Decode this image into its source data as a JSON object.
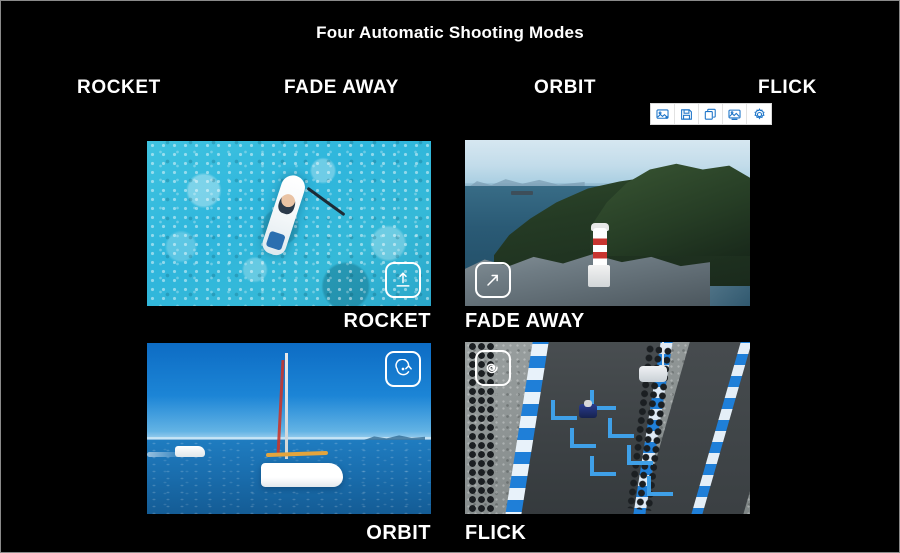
{
  "page": {
    "title": "Four Automatic Shooting Modes",
    "background_color": "#000000",
    "text_color": "#ffffff",
    "accent_color": "#1a73c8"
  },
  "mode_labels": [
    {
      "label": "ROCKET"
    },
    {
      "label": "FADE AWAY"
    },
    {
      "label": "ORBIT"
    },
    {
      "label": "FLICK"
    }
  ],
  "toolbar": {
    "buttons": [
      {
        "icon": "insert-image-icon",
        "label": "Insert image"
      },
      {
        "icon": "save-disk-icon",
        "label": "Save"
      },
      {
        "icon": "copy-duplicate-icon",
        "label": "Duplicate"
      },
      {
        "icon": "edit-image-icon",
        "label": "Edit image"
      },
      {
        "icon": "gear-icon",
        "label": "Settings"
      }
    ]
  },
  "gallery": {
    "items": [
      {
        "caption": "ROCKET",
        "badge_icon": "rocket-launch-up-icon",
        "alt": "Aerial view of a paddleboarder on turquoise water"
      },
      {
        "caption": "FADE AWAY",
        "badge_icon": "diagonal-arrow-out-icon",
        "alt": "Lighthouse on a rocky green headland by the sea"
      },
      {
        "caption": "ORBIT",
        "badge_icon": "orbit-circle-arrow-icon",
        "alt": "White sailboat on blue open water with motorboat behind"
      },
      {
        "caption": "FLICK",
        "badge_icon": "spiral-flick-icon",
        "alt": "Aerial view of a go-kart on a blue-kerbed racing circuit"
      }
    ]
  }
}
